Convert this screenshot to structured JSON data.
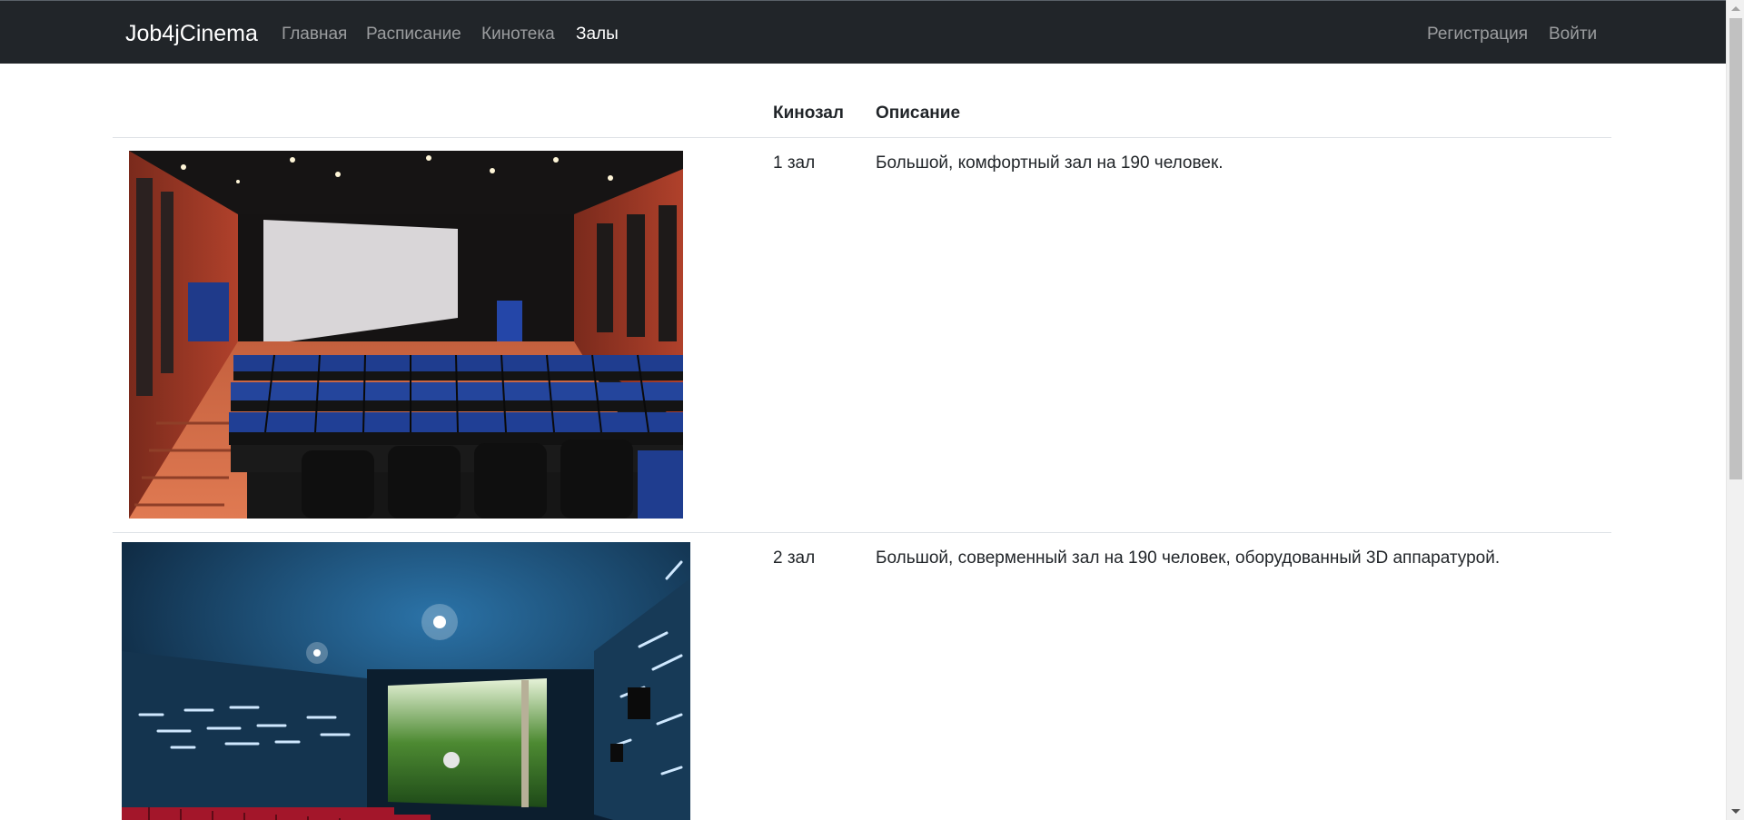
{
  "navbar": {
    "brand": "Job4jCinema",
    "links": [
      {
        "label": "Главная",
        "active": false
      },
      {
        "label": "Расписание",
        "active": false
      },
      {
        "label": "Кинотека",
        "active": false
      },
      {
        "label": "Залы",
        "active": true
      }
    ],
    "auth": {
      "register": "Регистрация",
      "login": "Войти"
    }
  },
  "table": {
    "headers": {
      "image": "",
      "hall": "Кинозал",
      "description": "Описание"
    },
    "rows": [
      {
        "hall": "1 зал",
        "description": "Большой, комфортный зал на 190 человек.",
        "image_icon": "cinema-hall-red-photo"
      },
      {
        "hall": "2 зал",
        "description": "Большой, соверменный зал на 190 человек, оборудованный 3D аппаратурой.",
        "image_icon": "cinema-hall-blue-photo"
      }
    ]
  },
  "colors": {
    "navbar_bg": "#212529",
    "nav_link": "rgba(255,255,255,0.55)",
    "nav_active": "#ffffff",
    "text": "#212529",
    "border": "#dee2e6"
  }
}
